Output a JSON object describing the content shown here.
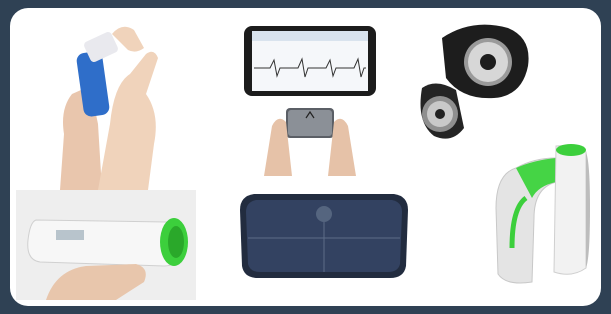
{
  "images": [
    {
      "id": "inhaler",
      "icon": "inhaler-device-image"
    },
    {
      "id": "ecg",
      "icon": "smartphone-ecg-image"
    },
    {
      "id": "tracker",
      "icon": "activity-tracker-image"
    },
    {
      "id": "thermometer",
      "icon": "smart-thermometer-image"
    },
    {
      "id": "scale",
      "icon": "smart-scale-image"
    },
    {
      "id": "bp-monitor",
      "icon": "blood-pressure-monitor-image"
    }
  ],
  "colors": {
    "background": "#2f4154",
    "panel": "#ffffff",
    "accent_green": "#3ccf3c",
    "inhaler_blue": "#2f6ec9"
  }
}
